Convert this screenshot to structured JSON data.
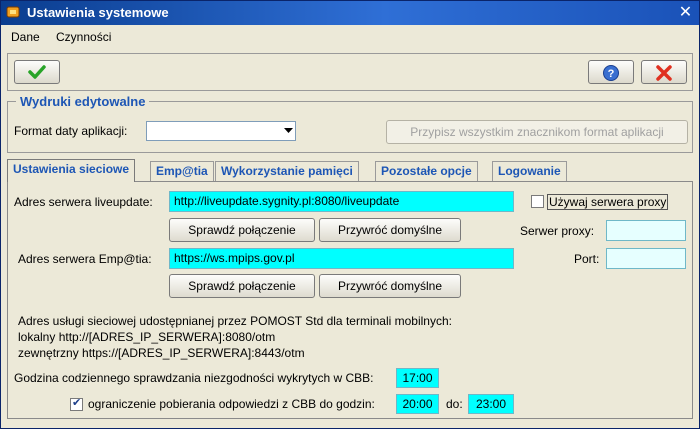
{
  "window": {
    "title": "Ustawienia systemowe",
    "close_label": "✕"
  },
  "menu": {
    "items": [
      {
        "label": "Dane"
      },
      {
        "label": "Czynności"
      }
    ]
  },
  "toolbar": {
    "accept_icon": "check-icon",
    "help_icon": "help-icon",
    "cancel_icon": "cancel-icon"
  },
  "print_group": {
    "title": "Wydruki edytowalne",
    "date_format_label": "Format daty aplikacji:",
    "date_format_value": "",
    "assign_button": "Przypisz wszystkim znacznikom format aplikacji"
  },
  "tabs": [
    {
      "label": "Ustawienia sieciowe",
      "active": true
    },
    {
      "label": "Emp@tia"
    },
    {
      "label": "Wykorzystanie pamięci"
    },
    {
      "label": "Pozostałe opcje"
    },
    {
      "label": "Logowanie"
    }
  ],
  "network": {
    "liveupdate_label": "Adres serwera liveupdate:",
    "liveupdate_value": "http://liveupdate.sygnity.pl:8080/liveupdate",
    "check_connection_1": "Sprawdź połączenie",
    "restore_default_1": "Przywróć domyślne",
    "use_proxy_label": "Używaj serwera proxy",
    "use_proxy_checked": false,
    "proxy_server_label": "Serwer proxy:",
    "proxy_server_value": "",
    "port_label": "Port:",
    "port_value": "",
    "empatia_label": "Adres serwera Emp@tia:",
    "empatia_value": "https://ws.mpips.gov.pl",
    "check_connection_2": "Sprawdź połączenie",
    "restore_default_2": "Przywróć domyślne",
    "service_info_line1": "Adres usługi sieciowej udostępnianej przez POMOST Std dla terminali mobilnych:",
    "service_info_line2": "lokalny http://[ADRES_IP_SERWERA]:8080/otm",
    "service_info_line3": "zewnętrzny https://[ADRES_IP_SERWERA]:8443/otm",
    "cbb_check_label": "Godzina codziennego sprawdzania niezgodności wykrytych w CBB:",
    "cbb_check_time": "17:00",
    "limit_label": "ograniczenie pobierania odpowiedzi z CBB do godzin:",
    "limit_checked": true,
    "limit_from": "20:00",
    "to_label": "do:",
    "limit_to": "23:00"
  },
  "colors": {
    "accent": "#1d56b5",
    "field_highlight": "#00ffff",
    "titlebar": "#0a3d8f"
  }
}
